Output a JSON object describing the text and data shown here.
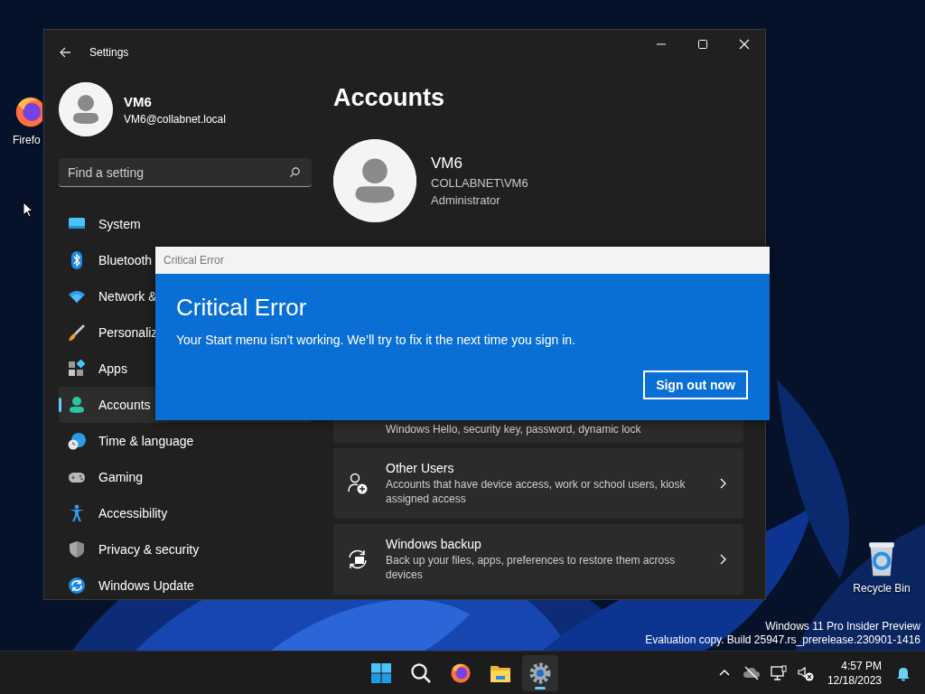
{
  "desktop_icons": [
    {
      "kind": "firefox",
      "label": "Firefo"
    },
    {
      "kind": "recycle",
      "label": "Recycle Bin"
    }
  ],
  "settings_window": {
    "title": "Settings",
    "user": {
      "name": "VM6",
      "email": "VM6@collabnet.local"
    },
    "search": {
      "placeholder": "Find a setting"
    },
    "nav": [
      {
        "kind": "system",
        "label": "System",
        "selected": false
      },
      {
        "kind": "bluetooth",
        "label": "Bluetooth",
        "selected": false
      },
      {
        "kind": "network",
        "label": "Network &",
        "selected": false
      },
      {
        "kind": "brush",
        "label": "Personaliz",
        "selected": false
      },
      {
        "kind": "apps",
        "label": "Apps",
        "selected": false
      },
      {
        "kind": "accounts",
        "label": "Accounts",
        "selected": true
      },
      {
        "kind": "time",
        "label": "Time & language",
        "selected": false
      },
      {
        "kind": "gaming",
        "label": "Gaming",
        "selected": false
      },
      {
        "kind": "accessibility",
        "label": "Accessibility",
        "selected": false
      },
      {
        "kind": "privacy",
        "label": "Privacy & security",
        "selected": false
      },
      {
        "kind": "update",
        "label": "Windows Update",
        "selected": false
      }
    ],
    "page_title": "Accounts",
    "account": {
      "name": "VM6",
      "domain": "COLLABNET\\VM6",
      "role": "Administrator"
    },
    "cards": [
      {
        "kind": "partial",
        "description": "Windows Hello, security key, password, dynamic lock"
      },
      {
        "kind": "users",
        "title": "Other Users",
        "description": "Accounts that have device access, work or school users, kiosk assigned access"
      },
      {
        "kind": "backup",
        "title": "Windows backup",
        "description": "Back up your files, apps, preferences to restore them across devices"
      }
    ]
  },
  "dialog": {
    "title": "Critical Error",
    "heading": "Critical Error",
    "message": "Your Start menu isn’t working. We’ll try to fix it the next time you sign in.",
    "button": "Sign out now"
  },
  "evaluation_notice": [
    "Windows 11 Pro Insider Preview",
    "Evaluation copy. Build 25947.rs_prerelease.230901-1416"
  ],
  "taskbar": {
    "apps": [
      {
        "kind": "start",
        "selected": false
      },
      {
        "kind": "search",
        "selected": false
      },
      {
        "kind": "firefox",
        "selected": false
      },
      {
        "kind": "explorer",
        "selected": false
      },
      {
        "kind": "settings",
        "selected": true
      }
    ],
    "tray": {
      "time": "4:57 PM",
      "date": "12/18/2023"
    }
  }
}
